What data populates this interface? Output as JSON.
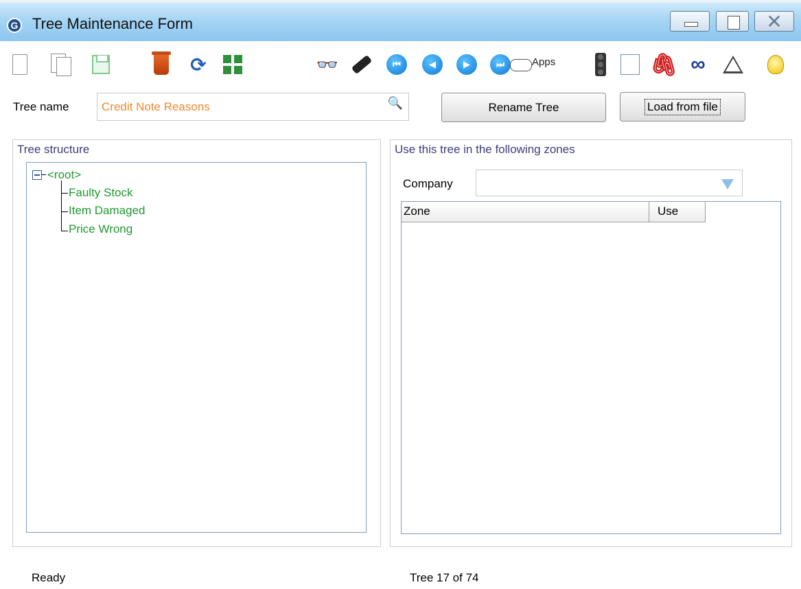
{
  "window": {
    "title": "Tree Maintenance Form",
    "logo_letter": "G"
  },
  "window_controls": {
    "close_glyph": "✕"
  },
  "toolbar": {
    "icons": [
      "new-document-icon",
      "copy-document-icon",
      "save-icon",
      "delete-icon",
      "refresh-icon",
      "tree-grid-icon",
      "binoculars-icon",
      "flashlight-icon",
      "first-record-icon",
      "previous-record-icon",
      "next-record-icon",
      "last-record-icon",
      "apps-icon",
      "traffic-light-icon",
      "note-icon",
      "attachment-icon",
      "link-icon",
      "warning-icon",
      "lightbulb-icon"
    ],
    "apps_label": "Apps",
    "binoculars_glyph": "👓",
    "refresh_glyph": "⟳",
    "first_glyph": "⏮",
    "prev_glyph": "◀",
    "next_glyph": "▶",
    "last_glyph": "⏭",
    "clip_glyph": "🖇",
    "link_glyph": "∞",
    "search_glyph": "🔍"
  },
  "form": {
    "tree_name_label": "Tree name",
    "tree_name_value": "Credit Note Reasons",
    "rename_button": "Rename Tree",
    "load_button": "Load from file"
  },
  "tree_panel": {
    "title": "Tree structure",
    "root": "<root>",
    "children": [
      "Faulty Stock",
      "Item Damaged",
      "Price Wrong"
    ]
  },
  "zones_panel": {
    "title": "Use this tree in the following zones",
    "company_label": "Company",
    "company_value": "",
    "columns": [
      "Zone",
      "Use"
    ]
  },
  "status": {
    "left": "Ready",
    "right": "Tree 17 of 74"
  },
  "colors": {
    "tree_text": "#1f9a2e",
    "tree_name_text": "#f08a2c",
    "titlebar": "#a9d6f5"
  }
}
